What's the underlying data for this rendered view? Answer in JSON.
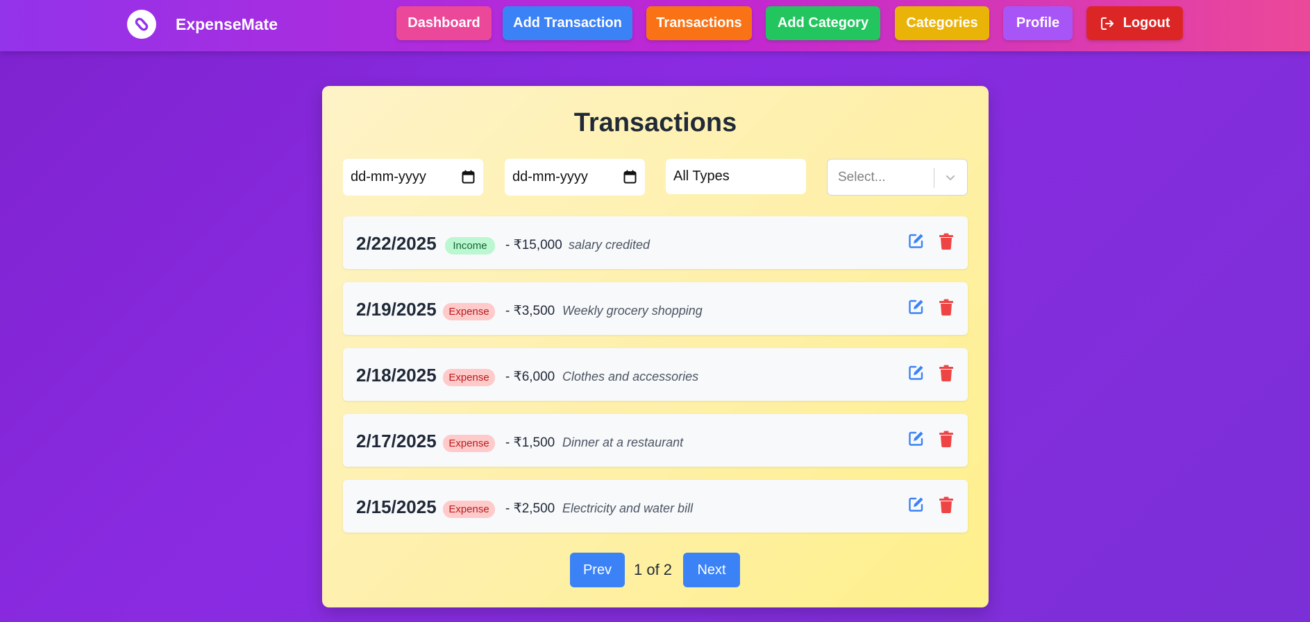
{
  "brand": {
    "name": "ExpenseMate",
    "logo_icon": "link-logo-icon"
  },
  "nav": [
    {
      "label": "Dashboard",
      "color": "#ec4899"
    },
    {
      "label": "Add Transaction",
      "color": "#3b82f6"
    },
    {
      "label": "Transactions",
      "color": "#f97316"
    },
    {
      "label": "Add Category",
      "color": "#22c55e"
    },
    {
      "label": "Categories",
      "color": "#eab308"
    },
    {
      "label": "Profile",
      "color": "#a855f7"
    },
    {
      "label": "Logout",
      "color": "#dc2626",
      "icon": "logout-icon"
    }
  ],
  "page": {
    "title": "Transactions"
  },
  "filters": {
    "start_date_placeholder": "dd-mm-yyyy",
    "end_date_placeholder": "dd-mm-yyyy",
    "type_value": "All Types",
    "category_placeholder": "Select..."
  },
  "transactions": [
    {
      "date": "2/22/2025",
      "type": "Income",
      "amount": "- ₹15,000",
      "note": "salary credited"
    },
    {
      "date": "2/19/2025",
      "type": "Expense",
      "amount": "- ₹3,500",
      "note": "Weekly grocery shopping"
    },
    {
      "date": "2/18/2025",
      "type": "Expense",
      "amount": "- ₹6,000",
      "note": "Clothes and accessories"
    },
    {
      "date": "2/17/2025",
      "type": "Expense",
      "amount": "- ₹1,500",
      "note": "Dinner at a restaurant"
    },
    {
      "date": "2/15/2025",
      "type": "Expense",
      "amount": "- ₹2,500",
      "note": "Electricity and water bill"
    }
  ],
  "pagination": {
    "prev_label": "Prev",
    "info": "1 of 2",
    "next_label": "Next"
  },
  "colors": {
    "income_badge": "#bbf7d0",
    "expense_badge": "#fecaca",
    "edit_icon": "#3b82f6",
    "delete_icon": "#ef4444",
    "pagination_button": "#3b82f6"
  }
}
